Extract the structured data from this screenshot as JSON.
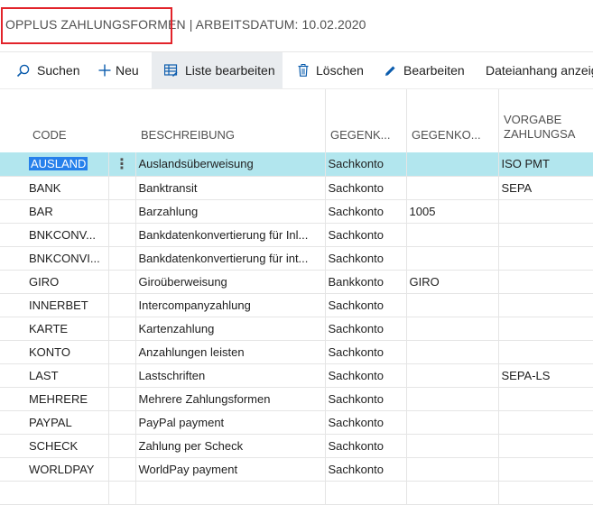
{
  "header": {
    "title_left": "OPPLUS ZAHLUNGSFORMEN",
    "separator": "|",
    "title_right": "ARBEITSDATUM: 10.02.2020"
  },
  "toolbar": {
    "search_label": "Suchen",
    "new_label": "Neu",
    "edit_list_label": "Liste bearbeiten",
    "delete_label": "Löschen",
    "edit_label": "Bearbeiten",
    "attachment_label": "Dateianhang anzeig"
  },
  "columns": {
    "code": "CODE",
    "description": "BESCHREIBUNG",
    "counter_type": "GEGENK...",
    "counter_no": "GEGENKO...",
    "default_line1": "VORGABE",
    "default_line2": "ZAHLUNGSA"
  },
  "row_menu_glyph": "⋮",
  "rows": [
    {
      "code": "AUSLAND",
      "description": "Auslandsüberweisung",
      "counter_type": "Sachkonto",
      "counter_no": "",
      "default": "ISO PMT"
    },
    {
      "code": "BANK",
      "description": "Banktransit",
      "counter_type": "Sachkonto",
      "counter_no": "",
      "default": "SEPA"
    },
    {
      "code": "BAR",
      "description": "Barzahlung",
      "counter_type": "Sachkonto",
      "counter_no": "1005",
      "default": ""
    },
    {
      "code": "BNKCONV...",
      "description": "Bankdatenkonvertierung für Inl...",
      "counter_type": "Sachkonto",
      "counter_no": "",
      "default": ""
    },
    {
      "code": "BNKCONVI...",
      "description": "Bankdatenkonvertierung für int...",
      "counter_type": "Sachkonto",
      "counter_no": "",
      "default": ""
    },
    {
      "code": "GIRO",
      "description": "Giroüberweisung",
      "counter_type": "Bankkonto",
      "counter_no": "GIRO",
      "default": ""
    },
    {
      "code": "INNERBET",
      "description": "Intercompanyzahlung",
      "counter_type": "Sachkonto",
      "counter_no": "",
      "default": ""
    },
    {
      "code": "KARTE",
      "description": "Kartenzahlung",
      "counter_type": "Sachkonto",
      "counter_no": "",
      "default": ""
    },
    {
      "code": "KONTO",
      "description": "Anzahlungen leisten",
      "counter_type": "Sachkonto",
      "counter_no": "",
      "default": ""
    },
    {
      "code": "LAST",
      "description": "Lastschriften",
      "counter_type": "Sachkonto",
      "counter_no": "",
      "default": "SEPA-LS"
    },
    {
      "code": "MEHRERE",
      "description": "Mehrere Zahlungsformen",
      "counter_type": "Sachkonto",
      "counter_no": "",
      "default": ""
    },
    {
      "code": "PAYPAL",
      "description": "PayPal payment",
      "counter_type": "Sachkonto",
      "counter_no": "",
      "default": ""
    },
    {
      "code": "SCHECK",
      "description": "Zahlung per Scheck",
      "counter_type": "Sachkonto",
      "counter_no": "",
      "default": ""
    },
    {
      "code": "WORLDPAY",
      "description": "WorldPay payment",
      "counter_type": "Sachkonto",
      "counter_no": "",
      "default": ""
    }
  ],
  "colors": {
    "selected_row": "#b2e6ee",
    "selected_code": "#2680eb",
    "highlight_box": "#e2232a",
    "icon_blue": "#0b5cad"
  }
}
